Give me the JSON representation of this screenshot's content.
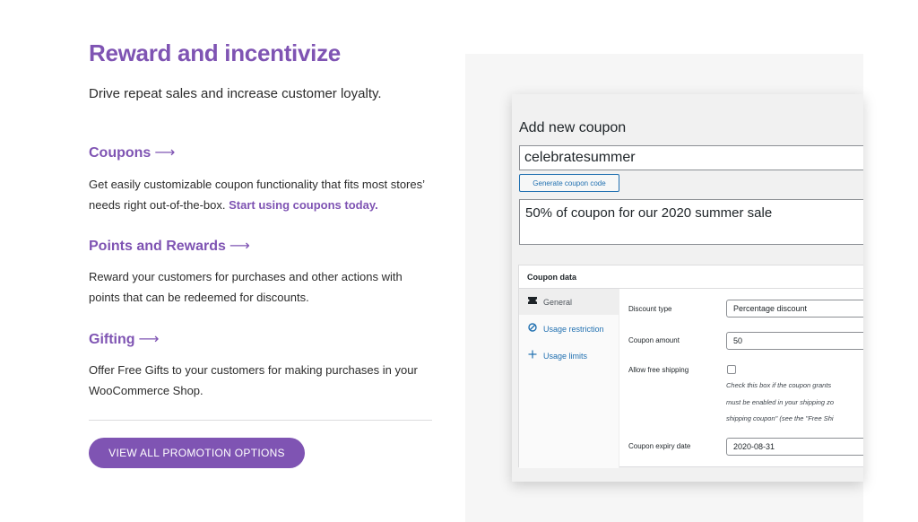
{
  "headline": "Reward and incentivize",
  "subhead": "Drive repeat sales and increase customer loyalty.",
  "arrow": "⟶",
  "sections": [
    {
      "title": "Coupons",
      "text": "Get easily customizable coupon functionality that fits most stores’ needs right out-of-the-box.",
      "link": "Start using coupons today."
    },
    {
      "title": "Points and Rewards",
      "text": "Reward your customers for purchases and other actions with points that can be redeemed for discounts."
    },
    {
      "title": "Gifting",
      "text": "Offer Free Gifts to your customers for making purchases in your WooCommerce Shop."
    }
  ],
  "cta_label": "VIEW ALL PROMOTION OPTIONS",
  "coupon": {
    "page_title": "Add new coupon",
    "code": "celebratesummer",
    "generate_label": "Generate coupon code",
    "description": "50% of coupon for our 2020 summer sale",
    "data_heading": "Coupon data",
    "tabs": [
      {
        "label": "General",
        "icon": "ticket-icon"
      },
      {
        "label": "Usage restriction",
        "icon": "block-icon"
      },
      {
        "label": "Usage limits",
        "icon": "plus-icon"
      }
    ],
    "fields": {
      "discount_type_label": "Discount type",
      "discount_type_value": "Percentage discount",
      "amount_label": "Coupon amount",
      "amount_value": "50",
      "free_shipping_label": "Allow free shipping",
      "free_shipping_checked": false,
      "free_shipping_help": [
        "Check this box if the coupon grants",
        "must be enabled in your shipping zo",
        "shipping coupon\" (see the \"Free Shi"
      ],
      "expiry_label": "Coupon expiry date",
      "expiry_value": "2020-08-31"
    }
  },
  "colors": {
    "brand_purple": "#7f54b3",
    "wp_blue": "#2271b1",
    "panel_bg": "#f6f6f6"
  }
}
